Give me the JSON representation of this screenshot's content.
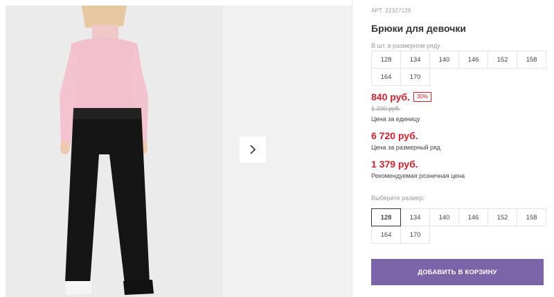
{
  "product": {
    "sku_label": "АРТ.",
    "sku_value": "22327129",
    "title": "Брюки для девочки",
    "image_alt": "product-photo-girl-pants"
  },
  "gallery": {
    "next_icon": "chevron-right-icon"
  },
  "size_row": {
    "caption": "В шт. в размерном ряду",
    "sizes": [
      "128",
      "134",
      "140",
      "146",
      "152",
      "158",
      "164",
      "170"
    ]
  },
  "pricing": {
    "current": "840 руб.",
    "discount": "30%",
    "old": "1 200 руб.",
    "unit_note": "Цена за единицу",
    "row_price": "6 720 руб.",
    "row_note": "Цена за размерный ряд",
    "retail_price": "1 379 руб.",
    "retail_note": "Рекомендуемая розничная цена",
    "accent_color": "#d4202c"
  },
  "size_select": {
    "caption": "Выберите размер:",
    "sizes": [
      "128",
      "134",
      "140",
      "146",
      "152",
      "158",
      "164",
      "170"
    ],
    "selected": "128"
  },
  "cart": {
    "button_label": "ДОБАВИТЬ В КОРЗИНУ",
    "button_color": "#7b65a8"
  }
}
